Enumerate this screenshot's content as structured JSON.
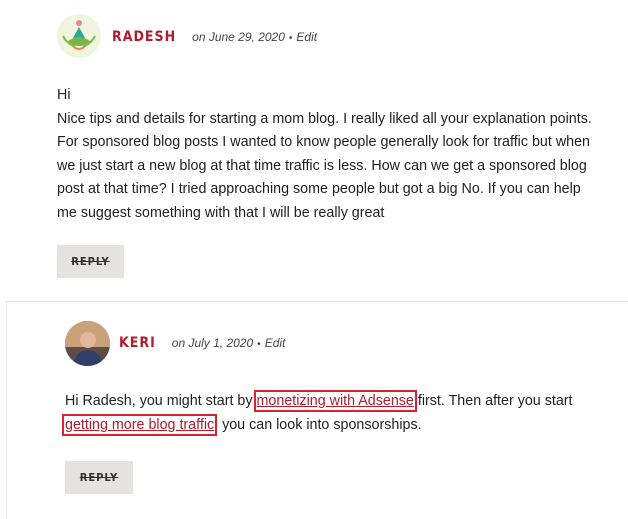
{
  "comment1": {
    "author": "Radesh",
    "date": "on June 29, 2020",
    "separator": "•",
    "edit": "Edit",
    "greeting": "Hi",
    "text": "Nice tips and details for starting a mom blog. I really liked all your explanation points. For sponsored blog posts I wanted to know people generally look for traffic but when we just start a new blog at that time traffic is less. How can we get a sponsored blog post at that time? I tried approaching some people but got a big No. If you can help me suggest something with that I will be really great",
    "reply": "Reply"
  },
  "comment2": {
    "author": "Keri",
    "date": "on July 1, 2020",
    "separator": "•",
    "edit": "Edit",
    "text_before": "Hi Radesh, you might start by ",
    "link1": "monetizing with Adsense",
    "text_middle": " first. Then after you start ",
    "link2": "getting more blog traffic",
    "text_after": ", you can look into sponsorships.",
    "reply": "Reply"
  },
  "colors": {
    "accent": "#b31b2b",
    "highlight_box": "#d8232f",
    "button_bg": "#e6e2df"
  },
  "icons": {
    "avatar1": "lotus-yoga-logo-avatar",
    "avatar2": "user-photo-avatar"
  }
}
